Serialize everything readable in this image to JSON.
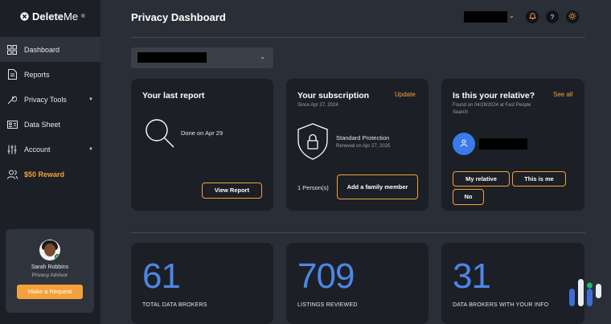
{
  "brand": {
    "name_bold": "Delete",
    "name_light": "Me",
    "mark": "®"
  },
  "sidebar": {
    "items": [
      {
        "label": "Dashboard",
        "icon": "grid-icon",
        "active": true
      },
      {
        "label": "Reports",
        "icon": "document-icon"
      },
      {
        "label": "Privacy Tools",
        "icon": "wrench-icon",
        "has_caret": true
      },
      {
        "label": "Data Sheet",
        "icon": "id-card-icon"
      },
      {
        "label": "Account",
        "icon": "sliders-icon",
        "has_caret": true
      },
      {
        "label": "$50 Reward",
        "icon": "users-icon",
        "highlight": true
      }
    ],
    "advisor": {
      "name": "Sarah Robbins",
      "role": "Privacy Advisor",
      "button": "Make a Request"
    }
  },
  "header": {
    "title": "Privacy Dashboard",
    "help": "?"
  },
  "report_card": {
    "title": "Your last report",
    "status": "Done on Apr 29",
    "button": "View Report"
  },
  "subscription_card": {
    "title": "Your subscription",
    "since": "Since Apr 27, 2024",
    "link": "Update",
    "plan": "Standard Protection",
    "renewal": "Renewal on Apr 27, 2025",
    "persons": "1 Person(s)",
    "button": "Add a family member"
  },
  "relative_card": {
    "title": "Is this your relative?",
    "link": "See all",
    "found": "Found on 04/28/2024 at Fast People Search",
    "buttons": {
      "my_relative": "My relative",
      "this_is_me": "This is me",
      "no": "No"
    }
  },
  "stats": [
    {
      "value": "61",
      "label": "TOTAL DATA BROKERS"
    },
    {
      "value": "709",
      "label": "LISTINGS REVIEWED"
    },
    {
      "value": "31",
      "label": "DATA BROKERS WITH YOUR INFO"
    }
  ],
  "colors": {
    "accent": "#f5a13b",
    "number": "#4d86e6",
    "card": "#1c1f26",
    "sidebar": "#1c1f26",
    "background": "#2a2e37"
  }
}
